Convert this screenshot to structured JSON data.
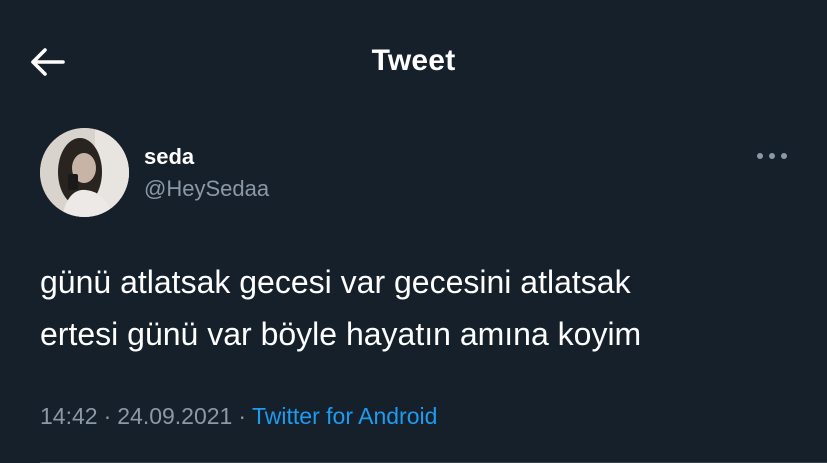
{
  "header": {
    "title": "Tweet",
    "back_icon": "arrow-left-icon"
  },
  "author": {
    "name": "seda",
    "handle": "@HeySedaa",
    "avatar_icon": "avatar"
  },
  "tweet": {
    "text": "günü atlatsak gecesi var gecesini atlatsak\nertesi günü var böyle hayatın amına koyim",
    "time": "14:42",
    "separator": "·",
    "date": "24.09.2021",
    "source": "Twitter for Android"
  },
  "more_icon": "more-horizontal-icon",
  "colors": {
    "background": "#15202b",
    "primary_text": "#ffffff",
    "secondary_text": "#8b98a5",
    "accent": "#1d9bf0",
    "divider": "#38444d"
  }
}
